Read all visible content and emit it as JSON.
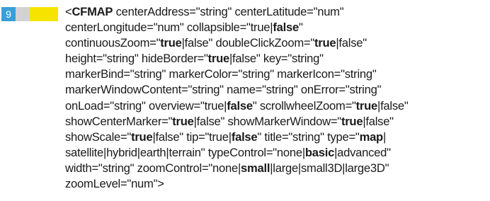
{
  "entry": {
    "number": "9",
    "badge_colors": [
      "#3a9fd8",
      "#d3d3d3",
      "#f6e400",
      "#f6e400"
    ]
  },
  "syntax_lines": [
    [
      {
        "t": "<"
      },
      {
        "t": "CFMAP",
        "b": true
      },
      {
        "t": " centerAddress=\"string\" centerLatitude=\"num\""
      }
    ],
    [
      {
        "t": "centerLongitude=\"num\" collapsible=\"true|"
      },
      {
        "t": "false",
        "b": true
      },
      {
        "t": "\""
      }
    ],
    [
      {
        "t": "continuousZoom=\""
      },
      {
        "t": "true",
        "b": true
      },
      {
        "t": "|false\" doubleClickZoom=\""
      },
      {
        "t": "true",
        "b": true
      },
      {
        "t": "|false\""
      }
    ],
    [
      {
        "t": "height=\"string\" hideBorder=\""
      },
      {
        "t": "true",
        "b": true
      },
      {
        "t": "|false\" key=\"string\""
      }
    ],
    [
      {
        "t": "markerBind=\"string\" markerColor=\"string\" markerIcon=\"string\""
      }
    ],
    [
      {
        "t": "markerWindowContent=\"string\" name=\"string\" onError=\"string\""
      }
    ],
    [
      {
        "t": "onLoad=\"string\" overview=\"true|"
      },
      {
        "t": "false",
        "b": true
      },
      {
        "t": "\" scrollwheelZoom=\""
      },
      {
        "t": "true",
        "b": true
      },
      {
        "t": "|false\""
      }
    ],
    [
      {
        "t": "showCenterMarker=\""
      },
      {
        "t": "true",
        "b": true
      },
      {
        "t": "|false\" showMarkerWindow=\""
      },
      {
        "t": "true",
        "b": true
      },
      {
        "t": "|false\""
      }
    ],
    [
      {
        "t": "showScale=\""
      },
      {
        "t": "true",
        "b": true
      },
      {
        "t": "|false\" tip=\"true|"
      },
      {
        "t": "false",
        "b": true
      },
      {
        "t": "\" title=\"string\" type=\""
      },
      {
        "t": "map",
        "b": true
      },
      {
        "t": "|"
      }
    ],
    [
      {
        "t": "satellite|hybrid|earth|terrain\" typeControl=\"none|"
      },
      {
        "t": "basic",
        "b": true
      },
      {
        "t": "|advanced\""
      }
    ],
    [
      {
        "t": "width=\"string\" zoomControl=\"none|"
      },
      {
        "t": "small",
        "b": true
      },
      {
        "t": "|large|small3D|large3D\""
      }
    ],
    [
      {
        "t": "zoomLevel=\"num\">"
      }
    ]
  ]
}
